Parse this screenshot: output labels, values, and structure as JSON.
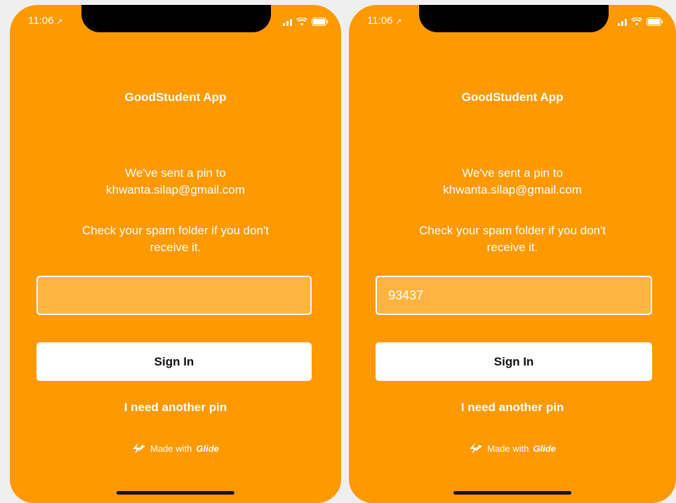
{
  "screens": [
    {
      "status": {
        "time": "11:06"
      },
      "app_title": "GoodStudent App",
      "message_line1": "We've sent a pin to",
      "message_line2": "khwanta.silap@gmail.com",
      "hint_line1": "Check your spam folder if you don't",
      "hint_line2": "receive it.",
      "pin_value": "",
      "sign_in_label": "Sign In",
      "another_pin_label": "I need another pin",
      "made_with_prefix": "Made with",
      "made_with_brand": "Glide"
    },
    {
      "status": {
        "time": "11:06"
      },
      "app_title": "GoodStudent App",
      "message_line1": "We've sent a pin to",
      "message_line2": "khwanta.silap@gmail.com",
      "hint_line1": "Check your spam folder if you don't",
      "hint_line2": "receive it.",
      "pin_value": "93437",
      "sign_in_label": "Sign In",
      "another_pin_label": "I need another pin",
      "made_with_prefix": "Made with",
      "made_with_brand": "Glide"
    }
  ],
  "icons": {
    "location": "location-arrow-icon",
    "signal": "cellular-signal-icon",
    "wifi": "wifi-icon",
    "battery": "battery-icon",
    "glide": "glide-logo-icon"
  },
  "colors": {
    "background": "#fe9900",
    "input_fill": "#ffb441",
    "button": "#ffffff",
    "text": "#ffffff"
  }
}
